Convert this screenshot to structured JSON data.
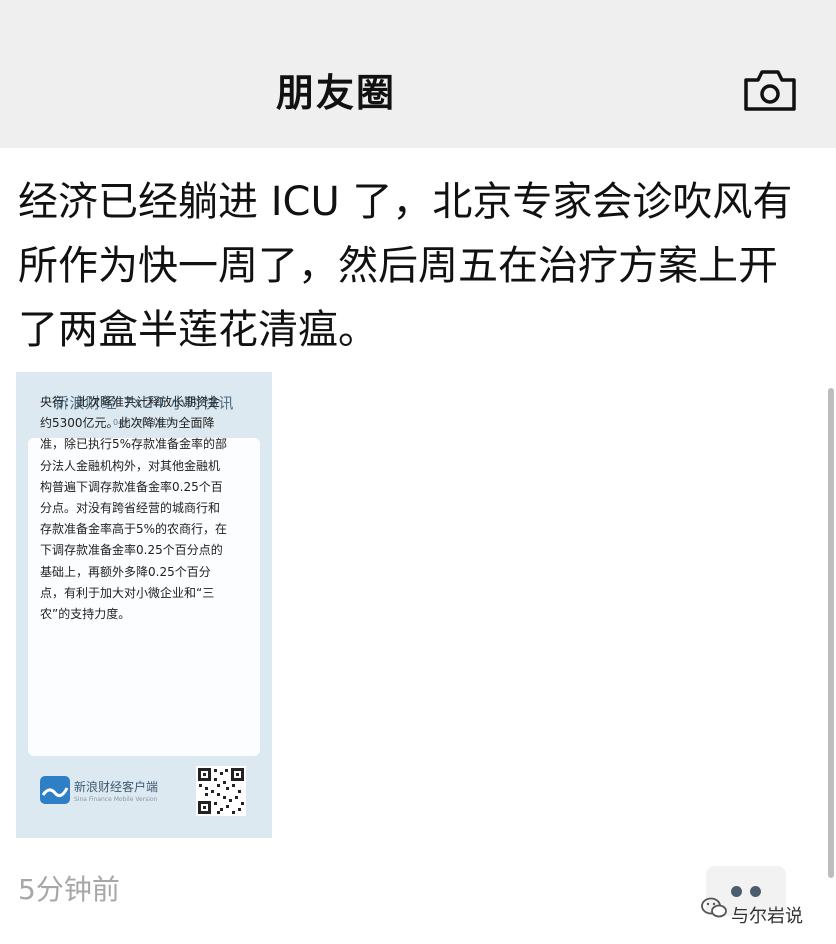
{
  "header": {
    "title": "朋友圈",
    "camera_icon": "camera-icon"
  },
  "post": {
    "text": "经济已经躺进 ICU 了，北京专家会诊吹风有所作为快一周了，然后周五在治疗方案上开了两盒半莲花清瘟。",
    "timestamp": "5分钟前",
    "more_icon": "more-dots-icon"
  },
  "card": {
    "title": "新浪财经 7x24 小时快讯",
    "time": "04月15日 18:16",
    "body": "央行：此次降准共计释放长期资金约5300亿元。此次降准为全面降准，除已执行5%存款准备金率的部分法人金融机构外，对其他金融机构普遍下调存款准备金率0.25个百分点。对没有跨省经营的城商行和存款准备金率高于5%的农商行，在下调存款准备金率0.25个百分点的基础上，再额外多降0.25个百分点，有利于加大对小微企业和“三农”的支持力度。",
    "footer_name": "新浪财经客户端",
    "footer_en": "Sina Finance Mobile Version",
    "logo_icon": "sina-finance-logo",
    "qr_icon": "qr-code"
  },
  "watermark": {
    "text": "与尔岩说",
    "icon": "wechat-icon"
  },
  "colors": {
    "header_bg": "#efefef",
    "card_bg": "#dde9f0",
    "timestamp": "#a7a7a7"
  }
}
